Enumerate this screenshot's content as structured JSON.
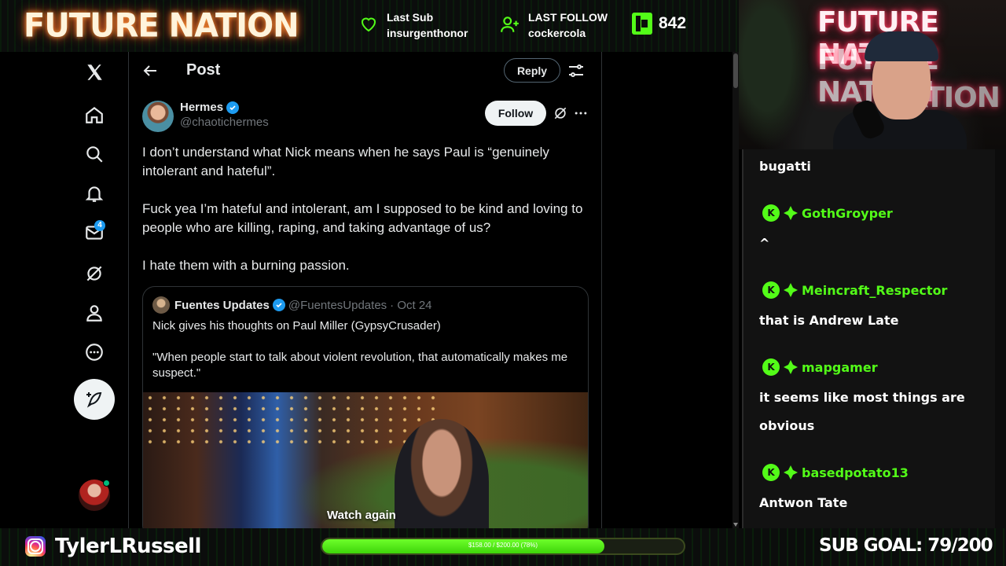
{
  "overlay": {
    "brand": "FUTURE NATION",
    "last_sub": {
      "label": "Last Sub",
      "name": "insurgenthonor"
    },
    "last_follow": {
      "label": "LAST FOLLOW",
      "name": "cockercola"
    },
    "kick_count": "842",
    "instagram_handle": "TylerLRussell",
    "goal_bar_text": "$158.00 / $200.00 (78%)",
    "goal_fraction": 0.78,
    "sub_goal": "SUB GOAL: 79/200",
    "accent_color": "#53fc18"
  },
  "webcam": {
    "neon_lines": [
      "FUTURE NATION",
      "FUTURE NATION",
      "NATION"
    ]
  },
  "x_nav": {
    "items": [
      {
        "name": "x-logo-icon"
      },
      {
        "name": "home-icon"
      },
      {
        "name": "search-icon"
      },
      {
        "name": "notifications-icon"
      },
      {
        "name": "messages-icon",
        "badge": "4"
      },
      {
        "name": "grok-icon"
      },
      {
        "name": "profile-icon"
      },
      {
        "name": "more-icon"
      }
    ]
  },
  "post": {
    "header_title": "Post",
    "reply_label": "Reply",
    "author_name": "Hermes",
    "author_handle": "@chaotichermes",
    "follow_label": "Follow",
    "paragraphs": [
      "I don’t understand what Nick means when he says Paul is “genuinely intolerant and hateful”.",
      "Fuck yea I’m hateful and intolerant, am I supposed to be kind and loving to people who are killing, raping, and taking advantage of us?",
      "I hate them with a burning passion."
    ],
    "quote": {
      "author_name": "Fuentes Updates",
      "author_handle": "@FuentesUpdates",
      "date": "· Oct 24",
      "line1": "Nick gives his thoughts on Paul Miller (GypsyCrusader)",
      "line2": "\"When people start to talk about violent revolution, that automatically makes me suspect.\"",
      "video_label": "Watch again"
    }
  },
  "chat": {
    "messages": [
      {
        "user": "",
        "text": "bugatti"
      },
      {
        "user": "GothGroyper",
        "text": "^"
      },
      {
        "user": "Meincraft_Respector",
        "text": "that is Andrew Late"
      },
      {
        "user": "mapgamer",
        "text": "it seems like most things are"
      },
      {
        "user": "",
        "text": "obvious"
      },
      {
        "user": "basedpotato13",
        "text": "Antwon Tate"
      }
    ]
  }
}
